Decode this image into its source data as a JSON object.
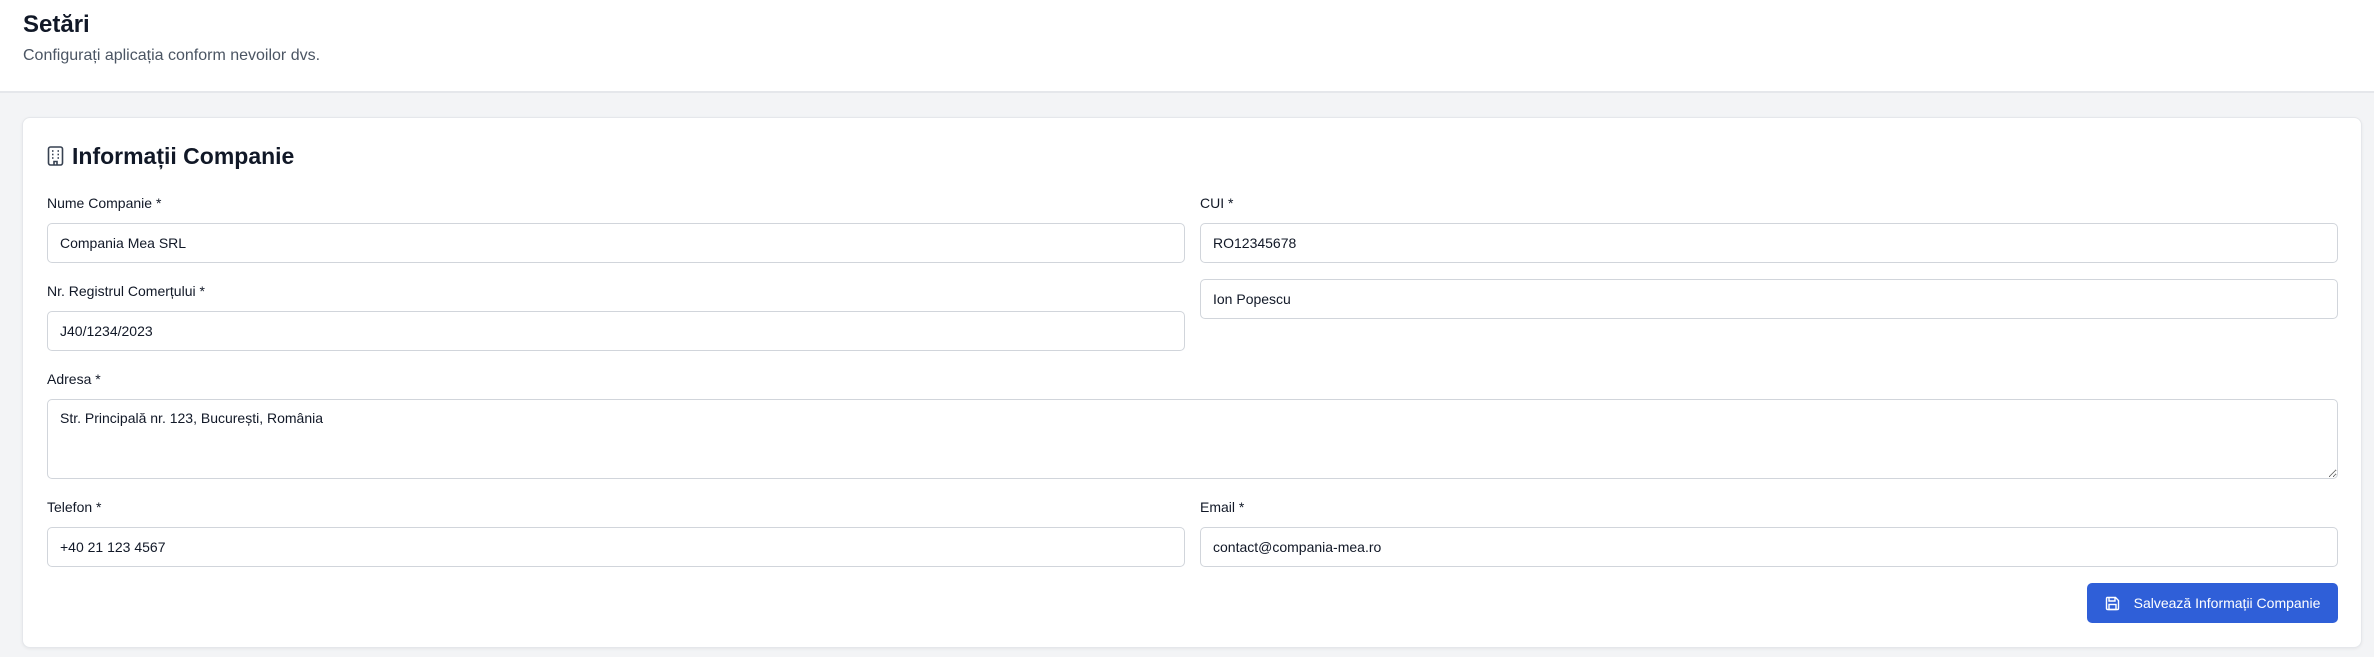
{
  "header": {
    "title": "Setări",
    "subtitle": "Configurați aplicația conform nevoilor dvs."
  },
  "company_section": {
    "title": "Informații Companie",
    "icon": "building-icon",
    "fields": {
      "company_name": {
        "label": "Nume Companie *",
        "value": "Compania Mea SRL"
      },
      "cui": {
        "label": "CUI *",
        "value": "RO12345678"
      },
      "registry_number": {
        "label": "Nr. Registrul Comerțului *",
        "value": "J40/1234/2023"
      },
      "representative": {
        "value": "Ion Popescu"
      },
      "address": {
        "label": "Adresa *",
        "value": "Str. Principală nr. 123, București, România"
      },
      "phone": {
        "label": "Telefon *",
        "value": "+40 21 123 4567"
      },
      "email": {
        "label": "Email *",
        "value": "contact@compania-mea.ro"
      }
    },
    "save_button": {
      "label": "Salvează Informații Companie",
      "icon": "save-icon"
    }
  },
  "colors": {
    "accent": "#2f5fd8",
    "page_background": "#f3f4f6",
    "card_background": "#ffffff",
    "border": "#d1d5db"
  }
}
